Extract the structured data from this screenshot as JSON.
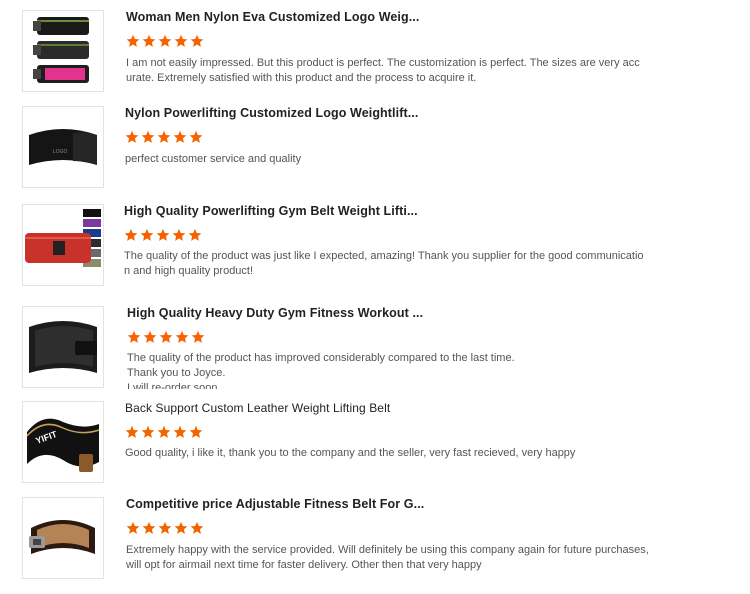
{
  "colors": {
    "star": "#f56300",
    "title": "#222222",
    "text": "#555555"
  },
  "reviews": [
    {
      "title": "Woman Men Nylon Eva Customized Logo Weig...",
      "rating": 5,
      "text": "I am not easily impressed. But this product is perfect.  The customization is perfect. The sizes are very acc\nurate. Extremely satisfied with this product and the process to acquire it."
    },
    {
      "title": "Nylon Powerlifting Customized Logo Weightlift...",
      "rating": 5,
      "text": "perfect customer service and quality",
      "logo": "LOGO"
    },
    {
      "title": "High Quality Powerlifting Gym Belt Weight Lifti...",
      "rating": 5,
      "text": "The quality of the product was just like I expected, amazing! Thank you supplier for the good communicatio\nn and high quality product!"
    },
    {
      "title": "High Quality Heavy Duty Gym Fitness Workout ...",
      "rating": 5,
      "text": "The quality of the product has improved considerably compared to the last time.\nThank you to Joyce.\nI will re-order soon"
    },
    {
      "title": "Back Support Custom Leather Weight Lifting Belt",
      "rating": 5,
      "text": "Good quality, i like it, thank you to the company and the seller, very fast recieved, very happy",
      "logo": "YIFIT"
    },
    {
      "title": "Competitive price Adjustable Fitness Belt For G...",
      "rating": 5,
      "text": "Extremely happy with the service provided. Will definitely be using this company again for future purchases,\nwill opt for airmail next time for faster delivery. Other then that very happy"
    }
  ]
}
